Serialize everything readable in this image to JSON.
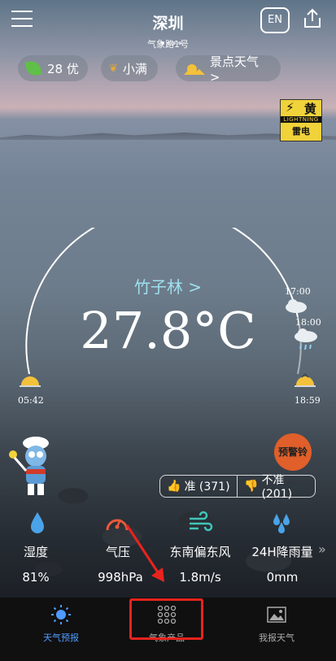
{
  "header": {
    "city": "深圳",
    "station": "气象路1号",
    "language_button": "EN"
  },
  "chips": {
    "aqi": "28 优",
    "solar_term": "小满",
    "scenic": "景点天气 >"
  },
  "warning": {
    "level": "黄",
    "type_en": "LIGHTNING",
    "type_cn": "雷电",
    "color": "#f0d23a"
  },
  "current": {
    "location": "竹子林 >",
    "temperature": "27.8°C",
    "sunrise": "05:42",
    "sunset": "18:59",
    "forecast_times": [
      "17:00",
      "18:00"
    ]
  },
  "votes": {
    "accurate": "准 (371)",
    "inaccurate": "不准 (201)"
  },
  "alarm_bell": "预警铃",
  "metrics": [
    {
      "label": "湿度",
      "value": "81%",
      "icon": "humidity-drop-icon"
    },
    {
      "label": "气压",
      "value": "998hPa",
      "icon": "pressure-gauge-icon"
    },
    {
      "label": "东南偏东风",
      "value": "1.8m/s",
      "icon": "wind-icon"
    },
    {
      "label": "24H降雨量",
      "value": "0mm",
      "icon": "rain-drops-icon"
    }
  ],
  "more_arrow": "»",
  "tabs": [
    {
      "label": "天气预报",
      "icon": "sun-icon",
      "active": true
    },
    {
      "label": "气象产品",
      "icon": "grid-dots-icon",
      "active": false
    },
    {
      "label": "我报天气",
      "icon": "photo-icon",
      "active": false
    }
  ],
  "colors": {
    "accent_active_tab": "#4f9bff",
    "annotation_red": "#e8231e",
    "location_text": "#9ee0ee"
  }
}
